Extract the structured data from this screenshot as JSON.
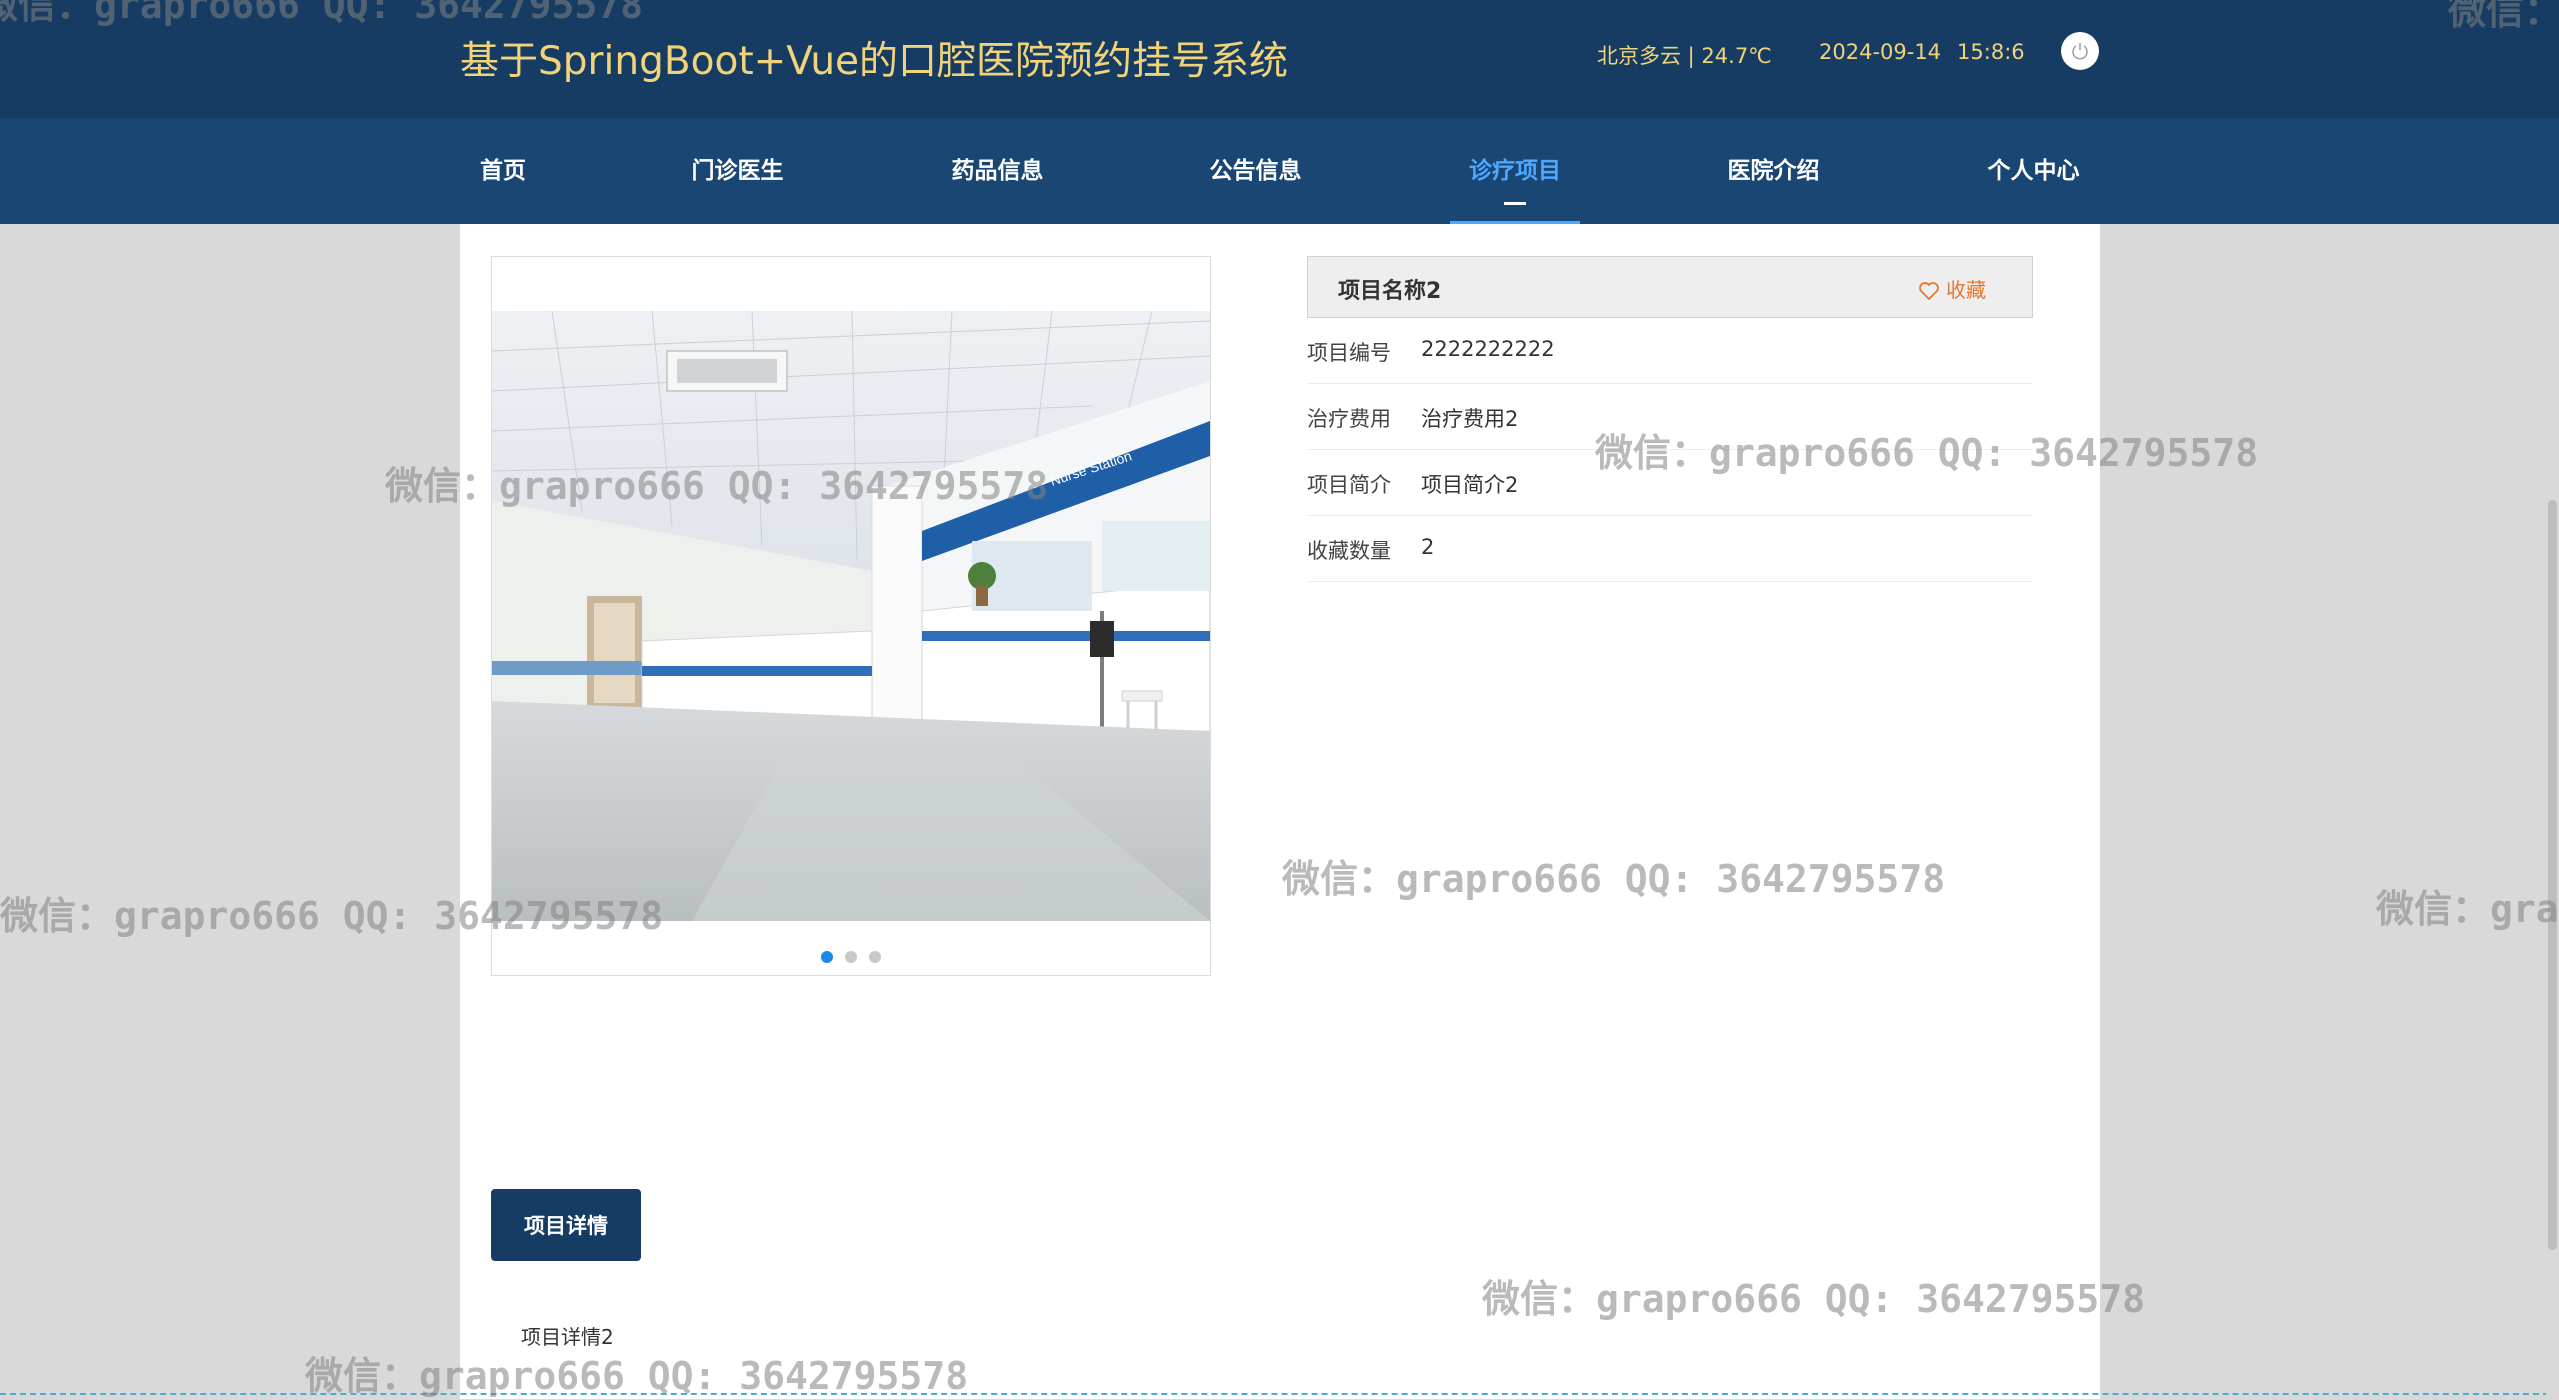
{
  "header": {
    "title": "基于SpringBoot+Vue的口腔医院预约挂号系统",
    "weather": "北京多云 | 24.7℃",
    "date": "2024-09-14",
    "time": "15:8:6",
    "logout_icon": "power-icon"
  },
  "nav": {
    "items": [
      {
        "label": "首页",
        "active": false
      },
      {
        "label": "门诊医生",
        "active": false
      },
      {
        "label": "药品信息",
        "active": false
      },
      {
        "label": "公告信息",
        "active": false
      },
      {
        "label": "诊疗项目",
        "active": true
      },
      {
        "label": "医院介绍",
        "active": false
      },
      {
        "label": "个人中心",
        "active": false
      }
    ]
  },
  "carousel": {
    "slide_count": 3,
    "active_index": 0
  },
  "project": {
    "name": "项目名称2",
    "favorite_label": "收藏",
    "favorite_icon": "heart-icon",
    "fields": [
      {
        "label": "项目编号",
        "value": "2222222222"
      },
      {
        "label": "治疗费用",
        "value": "治疗费用2"
      },
      {
        "label": "项目简介",
        "value": "项目简介2"
      },
      {
        "label": "收藏数量",
        "value": "2"
      }
    ]
  },
  "detail": {
    "tab_label": "项目详情",
    "content": "项目详情2"
  },
  "watermark": {
    "text": "微信：grapro666 QQ: 3642795578"
  },
  "colors": {
    "header_bg": "#163c63",
    "nav_bg": "#1a4674",
    "title_gold": "#f1d37a",
    "active_blue": "#4ea8ff",
    "favorite_orange": "#e8772e"
  }
}
